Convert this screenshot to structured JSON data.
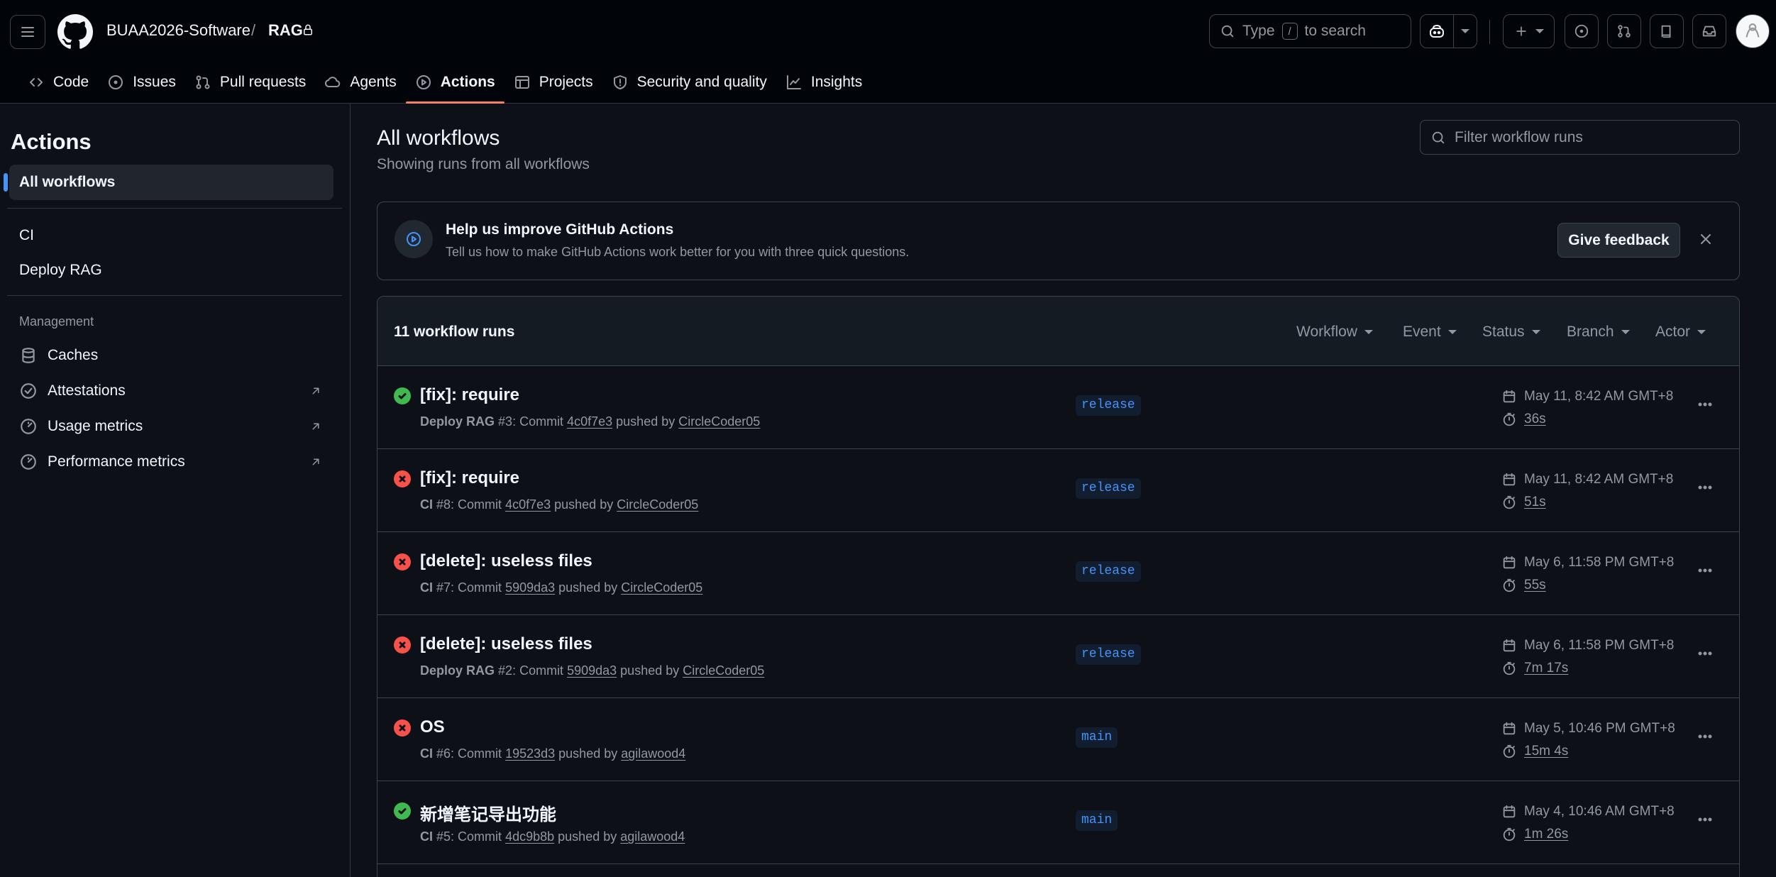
{
  "header": {
    "org": "BUAA2026-Software",
    "separator": "/",
    "repo": "RAG",
    "search_type": "Type",
    "search_key": "/",
    "search_rest": "to search"
  },
  "tabs": [
    {
      "label": "Code",
      "icon": "code-icon"
    },
    {
      "label": "Issues",
      "icon": "issue-icon"
    },
    {
      "label": "Pull requests",
      "icon": "pull-request-icon"
    },
    {
      "label": "Agents",
      "icon": "cloud-icon"
    },
    {
      "label": "Actions",
      "icon": "play-icon",
      "active": true
    },
    {
      "label": "Projects",
      "icon": "table-icon"
    },
    {
      "label": "Security and quality",
      "icon": "shield-icon"
    },
    {
      "label": "Insights",
      "icon": "graph-icon"
    }
  ],
  "sidebar": {
    "title": "Actions",
    "all_workflows": "All workflows",
    "workflows": [
      "CI",
      "Deploy RAG"
    ],
    "management_heading": "Management",
    "management": [
      {
        "label": "Caches",
        "icon": "database-icon",
        "external": false
      },
      {
        "label": "Attestations",
        "icon": "verified-icon",
        "external": true
      },
      {
        "label": "Usage metrics",
        "icon": "meter-icon",
        "external": true
      },
      {
        "label": "Performance metrics",
        "icon": "meter-icon",
        "external": true
      }
    ]
  },
  "main": {
    "title": "All workflows",
    "subtitle": "Showing runs from all workflows",
    "filter_placeholder": "Filter workflow runs"
  },
  "banner": {
    "title": "Help us improve GitHub Actions",
    "text": "Tell us how to make GitHub Actions work better for you with three quick questions.",
    "button": "Give feedback"
  },
  "runs_header": {
    "count": "11 workflow runs",
    "filters": [
      "Workflow",
      "Event",
      "Status",
      "Branch",
      "Actor"
    ]
  },
  "runs": [
    {
      "status": "success",
      "title": "[fix]: require",
      "workflow": "Deploy RAG",
      "number": "#3",
      "commit_label": ": Commit",
      "commit": "4c0f7e3",
      "pushed_by": "pushed by",
      "author": "CircleCoder05",
      "branch": "release",
      "date": "May 11, 8:42 AM GMT+8",
      "duration": "36s"
    },
    {
      "status": "failure",
      "title": "[fix]: require",
      "workflow": "CI",
      "number": "#8",
      "commit_label": ": Commit",
      "commit": "4c0f7e3",
      "pushed_by": "pushed by",
      "author": "CircleCoder05",
      "branch": "release",
      "date": "May 11, 8:42 AM GMT+8",
      "duration": "51s"
    },
    {
      "status": "failure",
      "title": "[delete]: useless files",
      "workflow": "CI",
      "number": "#7",
      "commit_label": ": Commit",
      "commit": "5909da3",
      "pushed_by": "pushed by",
      "author": "CircleCoder05",
      "branch": "release",
      "date": "May 6, 11:58 PM GMT+8",
      "duration": "55s"
    },
    {
      "status": "failure",
      "title": "[delete]: useless files",
      "workflow": "Deploy RAG",
      "number": "#2",
      "commit_label": ": Commit",
      "commit": "5909da3",
      "pushed_by": "pushed by",
      "author": "CircleCoder05",
      "branch": "release",
      "date": "May 6, 11:58 PM GMT+8",
      "duration": "7m 17s"
    },
    {
      "status": "failure",
      "title": "OS",
      "workflow": "CI",
      "number": "#6",
      "commit_label": ": Commit",
      "commit": "19523d3",
      "pushed_by": "pushed by",
      "author": "agilawood4",
      "branch": "main",
      "date": "May 5, 10:46 PM GMT+8",
      "duration": "15m 4s"
    },
    {
      "status": "success",
      "title": "新增笔记导出功能",
      "workflow": "CI",
      "number": "#5",
      "commit_label": ": Commit",
      "commit": "4dc9b8b",
      "pushed_by": "pushed by",
      "author": "agilawood4",
      "branch": "main",
      "date": "May 4, 10:46 AM GMT+8",
      "duration": "1m 26s"
    }
  ]
}
